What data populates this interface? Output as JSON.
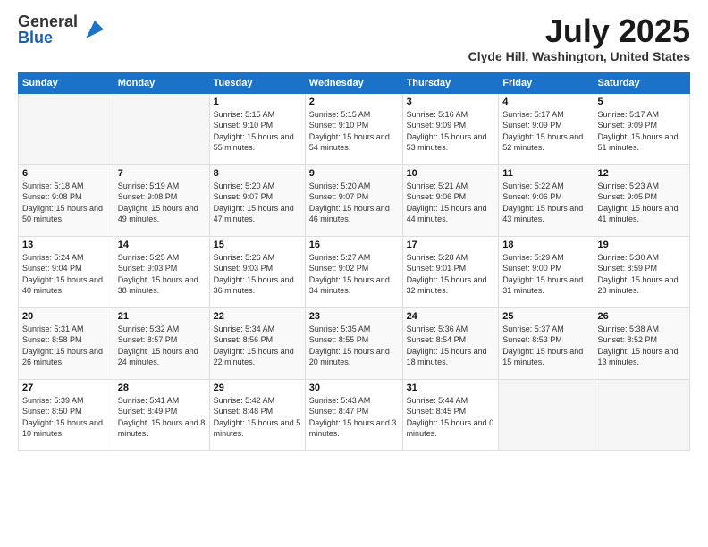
{
  "logo": {
    "general": "General",
    "blue": "Blue"
  },
  "title": {
    "month": "July 2025",
    "location": "Clyde Hill, Washington, United States"
  },
  "headers": [
    "Sunday",
    "Monday",
    "Tuesday",
    "Wednesday",
    "Thursday",
    "Friday",
    "Saturday"
  ],
  "weeks": [
    [
      {
        "day": "",
        "sunrise": "",
        "sunset": "",
        "daylight": ""
      },
      {
        "day": "",
        "sunrise": "",
        "sunset": "",
        "daylight": ""
      },
      {
        "day": "1",
        "sunrise": "Sunrise: 5:15 AM",
        "sunset": "Sunset: 9:10 PM",
        "daylight": "Daylight: 15 hours and 55 minutes."
      },
      {
        "day": "2",
        "sunrise": "Sunrise: 5:15 AM",
        "sunset": "Sunset: 9:10 PM",
        "daylight": "Daylight: 15 hours and 54 minutes."
      },
      {
        "day": "3",
        "sunrise": "Sunrise: 5:16 AM",
        "sunset": "Sunset: 9:09 PM",
        "daylight": "Daylight: 15 hours and 53 minutes."
      },
      {
        "day": "4",
        "sunrise": "Sunrise: 5:17 AM",
        "sunset": "Sunset: 9:09 PM",
        "daylight": "Daylight: 15 hours and 52 minutes."
      },
      {
        "day": "5",
        "sunrise": "Sunrise: 5:17 AM",
        "sunset": "Sunset: 9:09 PM",
        "daylight": "Daylight: 15 hours and 51 minutes."
      }
    ],
    [
      {
        "day": "6",
        "sunrise": "Sunrise: 5:18 AM",
        "sunset": "Sunset: 9:08 PM",
        "daylight": "Daylight: 15 hours and 50 minutes."
      },
      {
        "day": "7",
        "sunrise": "Sunrise: 5:19 AM",
        "sunset": "Sunset: 9:08 PM",
        "daylight": "Daylight: 15 hours and 49 minutes."
      },
      {
        "day": "8",
        "sunrise": "Sunrise: 5:20 AM",
        "sunset": "Sunset: 9:07 PM",
        "daylight": "Daylight: 15 hours and 47 minutes."
      },
      {
        "day": "9",
        "sunrise": "Sunrise: 5:20 AM",
        "sunset": "Sunset: 9:07 PM",
        "daylight": "Daylight: 15 hours and 46 minutes."
      },
      {
        "day": "10",
        "sunrise": "Sunrise: 5:21 AM",
        "sunset": "Sunset: 9:06 PM",
        "daylight": "Daylight: 15 hours and 44 minutes."
      },
      {
        "day": "11",
        "sunrise": "Sunrise: 5:22 AM",
        "sunset": "Sunset: 9:06 PM",
        "daylight": "Daylight: 15 hours and 43 minutes."
      },
      {
        "day": "12",
        "sunrise": "Sunrise: 5:23 AM",
        "sunset": "Sunset: 9:05 PM",
        "daylight": "Daylight: 15 hours and 41 minutes."
      }
    ],
    [
      {
        "day": "13",
        "sunrise": "Sunrise: 5:24 AM",
        "sunset": "Sunset: 9:04 PM",
        "daylight": "Daylight: 15 hours and 40 minutes."
      },
      {
        "day": "14",
        "sunrise": "Sunrise: 5:25 AM",
        "sunset": "Sunset: 9:03 PM",
        "daylight": "Daylight: 15 hours and 38 minutes."
      },
      {
        "day": "15",
        "sunrise": "Sunrise: 5:26 AM",
        "sunset": "Sunset: 9:03 PM",
        "daylight": "Daylight: 15 hours and 36 minutes."
      },
      {
        "day": "16",
        "sunrise": "Sunrise: 5:27 AM",
        "sunset": "Sunset: 9:02 PM",
        "daylight": "Daylight: 15 hours and 34 minutes."
      },
      {
        "day": "17",
        "sunrise": "Sunrise: 5:28 AM",
        "sunset": "Sunset: 9:01 PM",
        "daylight": "Daylight: 15 hours and 32 minutes."
      },
      {
        "day": "18",
        "sunrise": "Sunrise: 5:29 AM",
        "sunset": "Sunset: 9:00 PM",
        "daylight": "Daylight: 15 hours and 31 minutes."
      },
      {
        "day": "19",
        "sunrise": "Sunrise: 5:30 AM",
        "sunset": "Sunset: 8:59 PM",
        "daylight": "Daylight: 15 hours and 28 minutes."
      }
    ],
    [
      {
        "day": "20",
        "sunrise": "Sunrise: 5:31 AM",
        "sunset": "Sunset: 8:58 PM",
        "daylight": "Daylight: 15 hours and 26 minutes."
      },
      {
        "day": "21",
        "sunrise": "Sunrise: 5:32 AM",
        "sunset": "Sunset: 8:57 PM",
        "daylight": "Daylight: 15 hours and 24 minutes."
      },
      {
        "day": "22",
        "sunrise": "Sunrise: 5:34 AM",
        "sunset": "Sunset: 8:56 PM",
        "daylight": "Daylight: 15 hours and 22 minutes."
      },
      {
        "day": "23",
        "sunrise": "Sunrise: 5:35 AM",
        "sunset": "Sunset: 8:55 PM",
        "daylight": "Daylight: 15 hours and 20 minutes."
      },
      {
        "day": "24",
        "sunrise": "Sunrise: 5:36 AM",
        "sunset": "Sunset: 8:54 PM",
        "daylight": "Daylight: 15 hours and 18 minutes."
      },
      {
        "day": "25",
        "sunrise": "Sunrise: 5:37 AM",
        "sunset": "Sunset: 8:53 PM",
        "daylight": "Daylight: 15 hours and 15 minutes."
      },
      {
        "day": "26",
        "sunrise": "Sunrise: 5:38 AM",
        "sunset": "Sunset: 8:52 PM",
        "daylight": "Daylight: 15 hours and 13 minutes."
      }
    ],
    [
      {
        "day": "27",
        "sunrise": "Sunrise: 5:39 AM",
        "sunset": "Sunset: 8:50 PM",
        "daylight": "Daylight: 15 hours and 10 minutes."
      },
      {
        "day": "28",
        "sunrise": "Sunrise: 5:41 AM",
        "sunset": "Sunset: 8:49 PM",
        "daylight": "Daylight: 15 hours and 8 minutes."
      },
      {
        "day": "29",
        "sunrise": "Sunrise: 5:42 AM",
        "sunset": "Sunset: 8:48 PM",
        "daylight": "Daylight: 15 hours and 5 minutes."
      },
      {
        "day": "30",
        "sunrise": "Sunrise: 5:43 AM",
        "sunset": "Sunset: 8:47 PM",
        "daylight": "Daylight: 15 hours and 3 minutes."
      },
      {
        "day": "31",
        "sunrise": "Sunrise: 5:44 AM",
        "sunset": "Sunset: 8:45 PM",
        "daylight": "Daylight: 15 hours and 0 minutes."
      },
      {
        "day": "",
        "sunrise": "",
        "sunset": "",
        "daylight": ""
      },
      {
        "day": "",
        "sunrise": "",
        "sunset": "",
        "daylight": ""
      }
    ]
  ]
}
